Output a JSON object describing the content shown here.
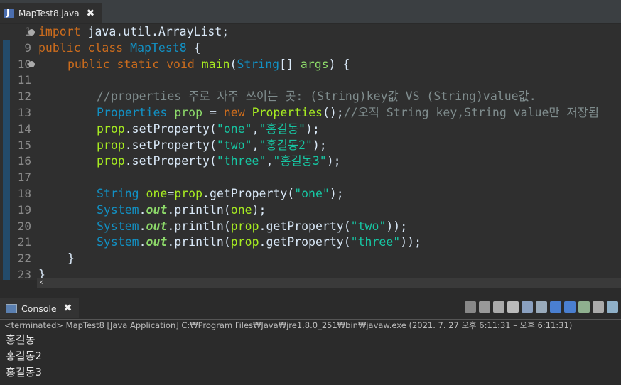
{
  "editor_tab": {
    "label": "MapTest8.java",
    "close": "✖"
  },
  "line_numbers": [
    "1",
    "9",
    "10",
    "11",
    "12",
    "13",
    "14",
    "15",
    "16",
    "17",
    "18",
    "19",
    "20",
    "21",
    "22",
    "23"
  ],
  "code": {
    "l1": {
      "kw": "import",
      "rest": " java.util.ArrayList;"
    },
    "l9": {
      "kw1": "public",
      "kw2": "class",
      "cls": "MapTest8",
      "rest": " {"
    },
    "l10": {
      "kw1": "public",
      "kw2": "static",
      "kw3": "void",
      "fn": "main",
      "p1": "(",
      "cls": "String",
      "p2": "[] ",
      "arg": "args",
      "p3": ") {"
    },
    "l12": {
      "comment": "//properties 주로 자주 쓰이는 곳: (String)key값 VS (String)value값."
    },
    "l13": {
      "cls": "Properties",
      "var": "prop",
      "eq": " = ",
      "kw": "new",
      "cls2": "Properties",
      "p": "();",
      "comment": "//오직 String key,String value만 저장됨"
    },
    "l14": {
      "obj": "prop",
      "m": ".setProperty(",
      "s1": "\"one\"",
      "c": ",",
      "s2": "\"홍길동\"",
      "e": ");"
    },
    "l15": {
      "obj": "prop",
      "m": ".setProperty(",
      "s1": "\"two\"",
      "c": ",",
      "s2": "\"홍길동2\"",
      "e": ");"
    },
    "l16": {
      "obj": "prop",
      "m": ".setProperty(",
      "s1": "\"three\"",
      "c": ",",
      "s2": "\"홍길동3\"",
      "e": ");"
    },
    "l18": {
      "cls": "String",
      "var": "one",
      "eq": "=",
      "obj": "prop",
      "m": ".getProperty(",
      "s": "\"one\"",
      "e": ");"
    },
    "l19": {
      "cls": "System",
      "dot": ".",
      "out": "out",
      "m": ".println(",
      "arg": "one",
      "e": ");"
    },
    "l20": {
      "cls": "System",
      "dot": ".",
      "out": "out",
      "m": ".println(",
      "obj": "prop",
      "m2": ".getProperty(",
      "s": "\"two\"",
      "e": "));"
    },
    "l21": {
      "cls": "System",
      "dot": ".",
      "out": "out",
      "m": ".println(",
      "obj": "prop",
      "m2": ".getProperty(",
      "s": "\"three\"",
      "e": "));"
    },
    "l22": {
      "brace": "}"
    },
    "l23": {
      "brace": "}"
    }
  },
  "console": {
    "tab_label": "Console",
    "close": "✖",
    "status": "<terminated> MapTest8 [Java Application] C:₩Program Files₩Java₩jre1.8.0_251₩bin₩javaw.exe  (2021. 7. 27 오후 6:11:31 – 오후 6:11:31)",
    "output": [
      "홍길동",
      "홍길동2",
      "홍길동3"
    ]
  },
  "scroll_arrow": "‹",
  "colors": {
    "keyword": "#cc6c1d",
    "class": "#1290c3",
    "string": "#17c6a3",
    "method": "#a7ec21",
    "comment": "#7f8c8d"
  }
}
